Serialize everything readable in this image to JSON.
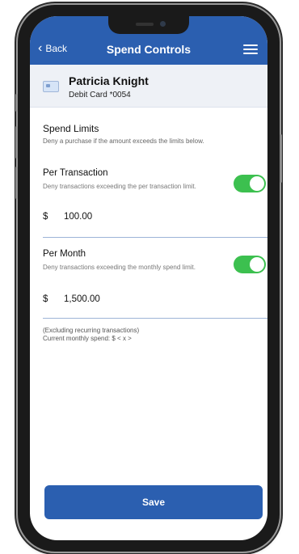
{
  "header": {
    "back_label": "Back",
    "title": "Spend Controls",
    "menu_icon": "hamburger-menu-icon",
    "back_icon": "chevron-left-icon"
  },
  "card": {
    "name": "Patricia Knight",
    "number": "Debit Card *0054",
    "icon": "credit-card-icon"
  },
  "spend_limits": {
    "title": "Spend Limits",
    "description": "Deny a purchase if the amount exceeds the limits below."
  },
  "per_transaction": {
    "title": "Per Transaction",
    "description": "Deny transactions exceeding the per transaction limit.",
    "currency": "$",
    "amount": "100.00",
    "enabled": true
  },
  "per_month": {
    "title": "Per Month",
    "description": "Deny transactions exceeding the monthly spend limit.",
    "currency": "$",
    "amount": "1,500.00",
    "enabled": true
  },
  "notes": {
    "excluding": "(Excluding recurring transactions)",
    "current": "Current monthly spend: $ < x >"
  },
  "save_label": "Save",
  "colors": {
    "primary": "#2b5fb0",
    "toggle_on": "#3cc04f",
    "card_bg": "#eef1f6"
  }
}
